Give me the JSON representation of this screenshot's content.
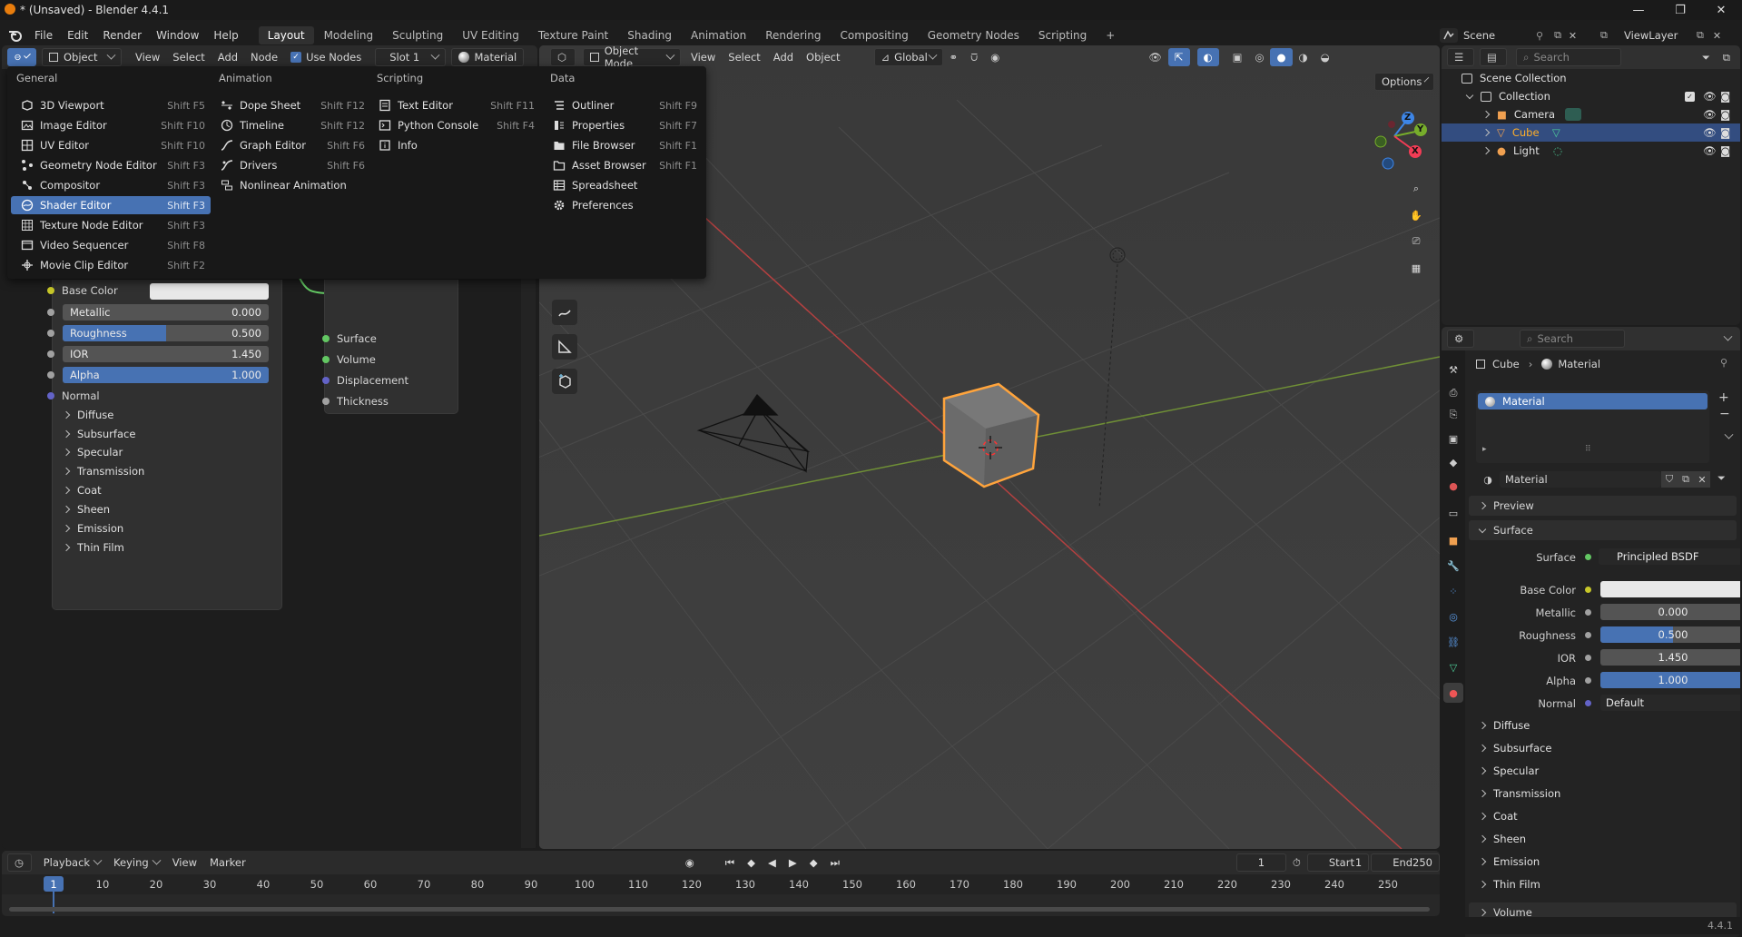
{
  "window": {
    "title": "* (Unsaved) - Blender 4.4.1"
  },
  "menubar": {
    "items": [
      "File",
      "Edit",
      "Render",
      "Window",
      "Help"
    ]
  },
  "workspaces": {
    "tabs": [
      "Layout",
      "Modeling",
      "Sculpting",
      "UV Editing",
      "Texture Paint",
      "Shading",
      "Animation",
      "Rendering",
      "Compositing",
      "Geometry Nodes",
      "Scripting"
    ],
    "active": "Layout"
  },
  "topright": {
    "scene": "Scene",
    "viewlayer": "ViewLayer"
  },
  "node_header": {
    "object_mode": "Object",
    "view": "View",
    "select": "Select",
    "add": "Add",
    "node": "Node",
    "use_nodes": "Use Nodes",
    "slot": "Slot 1",
    "material": "Material"
  },
  "editor_menu": {
    "columns": [
      {
        "title": "General",
        "items": [
          {
            "label": "3D Viewport",
            "shortcut": "Shift F5",
            "icon": "viewport-icon"
          },
          {
            "label": "Image Editor",
            "shortcut": "Shift F10",
            "icon": "image-icon"
          },
          {
            "label": "UV Editor",
            "shortcut": "Shift F10",
            "icon": "uv-icon"
          },
          {
            "label": "Geometry Node Editor",
            "shortcut": "Shift F3",
            "icon": "geometry-nodes-icon"
          },
          {
            "label": "Compositor",
            "shortcut": "Shift F3",
            "icon": "compositor-icon"
          },
          {
            "label": "Shader Editor",
            "shortcut": "Shift F3",
            "icon": "shader-icon",
            "selected": true
          },
          {
            "label": "Texture Node Editor",
            "shortcut": "Shift F3",
            "icon": "texture-icon"
          },
          {
            "label": "Video Sequencer",
            "shortcut": "Shift F8",
            "icon": "sequencer-icon"
          },
          {
            "label": "Movie Clip Editor",
            "shortcut": "Shift F2",
            "icon": "clip-icon"
          }
        ]
      },
      {
        "title": "Animation",
        "items": [
          {
            "label": "Dope Sheet",
            "shortcut": "Shift F12",
            "icon": "dopesheet-icon"
          },
          {
            "label": "Timeline",
            "shortcut": "Shift F12",
            "icon": "timeline-icon"
          },
          {
            "label": "Graph Editor",
            "shortcut": "Shift F6",
            "icon": "graph-icon"
          },
          {
            "label": "Drivers",
            "shortcut": "Shift F6",
            "icon": "drivers-icon"
          },
          {
            "label": "Nonlinear Animation",
            "shortcut": "",
            "icon": "nla-icon"
          }
        ]
      },
      {
        "title": "Scripting",
        "items": [
          {
            "label": "Text Editor",
            "shortcut": "Shift F11",
            "icon": "text-icon"
          },
          {
            "label": "Python Console",
            "shortcut": "Shift F4",
            "icon": "console-icon"
          },
          {
            "label": "Info",
            "shortcut": "",
            "icon": "info-icon"
          }
        ]
      },
      {
        "title": "Data",
        "items": [
          {
            "label": "Outliner",
            "shortcut": "Shift F9",
            "icon": "outliner-icon"
          },
          {
            "label": "Properties",
            "shortcut": "Shift F7",
            "icon": "properties-icon"
          },
          {
            "label": "File Browser",
            "shortcut": "Shift F1",
            "icon": "filebrowser-icon"
          },
          {
            "label": "Asset Browser",
            "shortcut": "Shift F1",
            "icon": "asset-icon"
          },
          {
            "label": "Spreadsheet",
            "shortcut": "",
            "icon": "spreadsheet-icon"
          },
          {
            "label": "Preferences",
            "shortcut": "",
            "icon": "preferences-icon"
          }
        ]
      }
    ]
  },
  "bsdf_node": {
    "base_color": "Base Color",
    "fields": [
      {
        "label": "Metallic",
        "value": "0.000",
        "fill": 0
      },
      {
        "label": "Roughness",
        "value": "0.500",
        "fill": 0.5
      },
      {
        "label": "IOR",
        "value": "1.450",
        "fill": 0
      },
      {
        "label": "Alpha",
        "value": "1.000",
        "fill": 1
      }
    ],
    "normal": "Normal",
    "panels": [
      "Diffuse",
      "Subsurface",
      "Specular",
      "Transmission",
      "Coat",
      "Sheen",
      "Emission",
      "Thin Film"
    ]
  },
  "output_node": {
    "sockets": [
      "Surface",
      "Volume",
      "Displacement",
      "Thickness"
    ]
  },
  "viewport_header": {
    "mode": "Object Mode",
    "view": "View",
    "select": "Select",
    "add": "Add",
    "object": "Object",
    "orientation": "Global",
    "options": "Options"
  },
  "gizmo": {
    "z": "Z",
    "y": "Y",
    "x": "X"
  },
  "outliner": {
    "search_placeholder": "Search",
    "root": "Scene Collection",
    "collection": "Collection",
    "objects": [
      {
        "name": "Camera",
        "icon": "camera-icon",
        "selected": false
      },
      {
        "name": "Cube",
        "icon": "mesh-icon",
        "selected": true
      },
      {
        "name": "Light",
        "icon": "light-icon",
        "selected": false
      }
    ]
  },
  "properties": {
    "search_placeholder": "Search",
    "breadcrumb": [
      "Cube",
      "Material"
    ],
    "slot": "Material",
    "material_name": "Material",
    "sections": {
      "preview": "Preview",
      "surface": "Surface"
    },
    "surface_label": "Surface",
    "surface_value": "Principled BSDF",
    "base_color_label": "Base Color",
    "fields": [
      {
        "label": "Metallic",
        "value": "0.000",
        "fill": 0
      },
      {
        "label": "Roughness",
        "value": "0.500",
        "fill": 0.5
      },
      {
        "label": "IOR",
        "value": "1.450",
        "fill": 0
      },
      {
        "label": "Alpha",
        "value": "1.000",
        "fill": 1
      }
    ],
    "normal_label": "Normal",
    "normal_value": "Default",
    "panels": [
      "Diffuse",
      "Subsurface",
      "Specular",
      "Transmission",
      "Coat",
      "Sheen",
      "Emission",
      "Thin Film",
      "Volume"
    ]
  },
  "timeline": {
    "playback": "Playback",
    "keying": "Keying",
    "view": "View",
    "marker": "Marker",
    "current_frame": "1",
    "start_label": "Start",
    "start": "1",
    "end_label": "End",
    "end": "250",
    "ticks": [
      "10",
      "20",
      "30",
      "40",
      "50",
      "60",
      "70",
      "80",
      "90",
      "100",
      "110",
      "120",
      "130",
      "140",
      "150",
      "160",
      "170",
      "180",
      "190",
      "200",
      "210",
      "220",
      "230",
      "240",
      "250"
    ],
    "playhead": "1"
  },
  "status": {
    "version": "4.4.1"
  },
  "colors": {
    "accent": "#4772b3",
    "selection": "#ffa43c",
    "x_axis": "#f23c55",
    "y_axis": "#77ad2b",
    "z_axis": "#3d85e6"
  }
}
